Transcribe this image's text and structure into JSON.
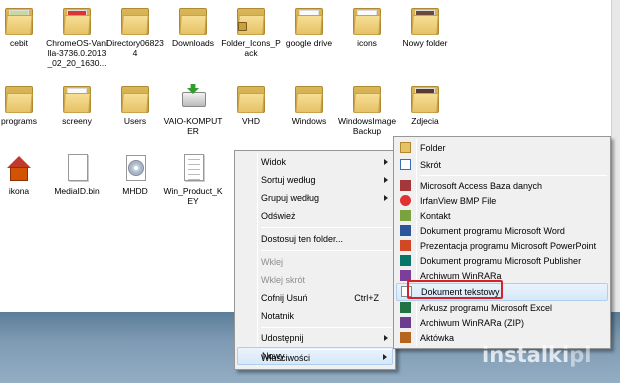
{
  "desktop_items": [
    {
      "label": "cebit",
      "kind": "folder-photo"
    },
    {
      "label": "ChromeOS-Vanilla-3736.0.2013_02_20_1630...",
      "kind": "folder-doc"
    },
    {
      "label": "Directory068234",
      "kind": "folder"
    },
    {
      "label": "Downloads",
      "kind": "folder"
    },
    {
      "label": "Folder_Icons_Pack",
      "kind": "folder-locked"
    },
    {
      "label": "google drive",
      "kind": "folder-doc"
    },
    {
      "label": "icons",
      "kind": "folder"
    },
    {
      "label": "Nowy folder",
      "kind": "folder-photo"
    },
    {
      "label": "programs",
      "kind": "folder"
    },
    {
      "label": "screeny",
      "kind": "folder"
    },
    {
      "label": "Users",
      "kind": "folder"
    },
    {
      "label": "VAIO-KOMPUTER",
      "kind": "disk"
    },
    {
      "label": "VHD",
      "kind": "folder"
    },
    {
      "label": "Windows",
      "kind": "folder"
    },
    {
      "label": "WindowsImageBackup",
      "kind": "folder"
    },
    {
      "label": "Zdjecia",
      "kind": "folder-photo"
    },
    {
      "label": "ikona",
      "kind": "house"
    },
    {
      "label": "MediaID.bin",
      "kind": "file"
    },
    {
      "label": "MHDD",
      "kind": "cd"
    },
    {
      "label": "Win_Product_KEY",
      "kind": "file"
    }
  ],
  "context_menu": {
    "items": [
      {
        "label": "Widok",
        "submenu": true
      },
      {
        "label": "Sortuj według",
        "submenu": true
      },
      {
        "label": "Grupuj według",
        "submenu": true
      },
      {
        "label": "Odśwież"
      },
      {
        "label": "Dostosuj ten folder..."
      },
      {
        "label": "Wklej",
        "disabled": true
      },
      {
        "label": "Wklej skrót",
        "disabled": true
      },
      {
        "label": "Cofnij Usuń",
        "shortcut": "Ctrl+Z"
      },
      {
        "label": "Notatnik"
      },
      {
        "label": "Udostępnij",
        "submenu": true
      },
      {
        "label": "Nowy",
        "submenu": true,
        "highlighted": true
      },
      {
        "label": "Właściwości"
      }
    ]
  },
  "new_submenu": {
    "items": [
      {
        "label": "Folder",
        "icon": "folder-icon"
      },
      {
        "label": "Skrót",
        "icon": "shortcut-icon"
      },
      {
        "label": "Microsoft Access Baza danych",
        "icon": "access-icon"
      },
      {
        "label": "IrfanView BMP File",
        "icon": "bmp-icon"
      },
      {
        "label": "Kontakt",
        "icon": "contact-icon"
      },
      {
        "label": "Dokument programu Microsoft Word",
        "icon": "word-icon"
      },
      {
        "label": "Prezentacja programu Microsoft PowerPoint",
        "icon": "powerpoint-icon"
      },
      {
        "label": "Dokument programu Microsoft Publisher",
        "icon": "publisher-icon"
      },
      {
        "label": "Archiwum WinRARa",
        "icon": "winrar-icon"
      },
      {
        "label": "Dokument tekstowy",
        "icon": "text-document-icon",
        "highlighted": true
      },
      {
        "label": "Arkusz programu Microsoft Excel",
        "icon": "excel-icon"
      },
      {
        "label": "Archiwum WinRARa (ZIP)",
        "icon": "winrar-zip-icon"
      },
      {
        "label": "Aktówka",
        "icon": "briefcase-icon"
      }
    ]
  },
  "watermark": {
    "main": "instalki",
    "suffix": "pl"
  },
  "colors": {
    "highlight_border": "#aecfee",
    "callout_red": "#d9202b",
    "folder_yellow": "#e5c266"
  }
}
